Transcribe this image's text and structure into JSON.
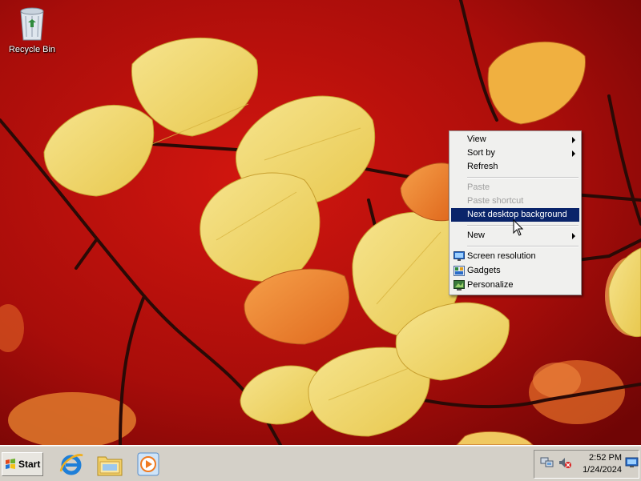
{
  "desktop": {
    "icons": [
      {
        "label": "Recycle Bin",
        "icon": "recycle-bin-icon"
      }
    ]
  },
  "context_menu": {
    "items": [
      {
        "label": "View",
        "submenu": true
      },
      {
        "label": "Sort by",
        "submenu": true
      },
      {
        "label": "Refresh"
      },
      {
        "label": "Paste",
        "disabled": true
      },
      {
        "label": "Paste shortcut",
        "disabled": true
      },
      {
        "label": "Next desktop background",
        "highlighted": true
      },
      {
        "label": "New",
        "submenu": true
      },
      {
        "label": "Screen resolution",
        "icon": "screen-resolution-icon"
      },
      {
        "label": "Gadgets",
        "icon": "gadgets-icon"
      },
      {
        "label": "Personalize",
        "icon": "personalize-icon"
      }
    ]
  },
  "taskbar": {
    "start_label": "Start",
    "quick_launch": [
      "internet-explorer-icon",
      "windows-explorer-icon",
      "media-player-icon"
    ],
    "tray_icons": [
      "network-icon",
      "volume-muted-icon",
      "show-desktop-icon"
    ],
    "clock": {
      "time": "2:52 PM",
      "date": "1/24/2024"
    }
  },
  "colors": {
    "wallpaper_red": "#a50c0a",
    "leaf_yellow": "#f3dc7a",
    "leaf_orange": "#f08a30",
    "menu_highlight": "#0a246a",
    "taskbar": "#d4d0c8"
  }
}
